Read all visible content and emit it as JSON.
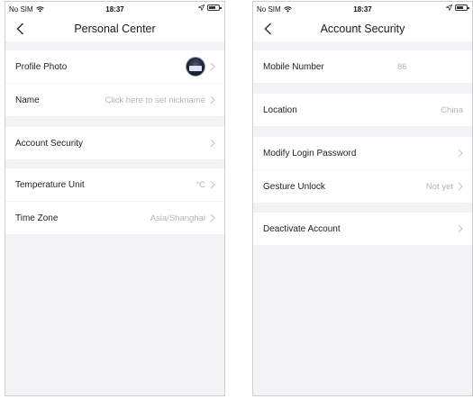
{
  "status_bar": {
    "carrier": "No SIM",
    "time": "18:37"
  },
  "left_screen": {
    "title": "Personal Center",
    "rows": [
      {
        "label": "Profile Photo",
        "value": ""
      },
      {
        "label": "Name",
        "value": "Click here to set nickname"
      },
      {
        "label": "Account Security",
        "value": ""
      },
      {
        "label": "Temperature Unit",
        "value": "°C"
      },
      {
        "label": "Time Zone",
        "value": "Asia/Shanghai"
      }
    ]
  },
  "right_screen": {
    "title": "Account Security",
    "rows": [
      {
        "label": "Mobile Number",
        "value": "86"
      },
      {
        "label": "Location",
        "value": "China"
      },
      {
        "label": "Modify Login Password",
        "value": ""
      },
      {
        "label": "Gesture Unlock",
        "value": "Not yet"
      },
      {
        "label": "Deactivate Account",
        "value": ""
      }
    ]
  },
  "icons": {
    "back": "chevron-left-icon",
    "row_arrow": "chevron-right-icon",
    "wifi": "wifi-icon",
    "location": "location-arrow-icon",
    "battery": "battery-icon"
  },
  "colors": {
    "background": "#f3f3f5",
    "row": "#ffffff",
    "secondary_text": "#b4b4b8",
    "chevron": "#c7c7cc"
  }
}
